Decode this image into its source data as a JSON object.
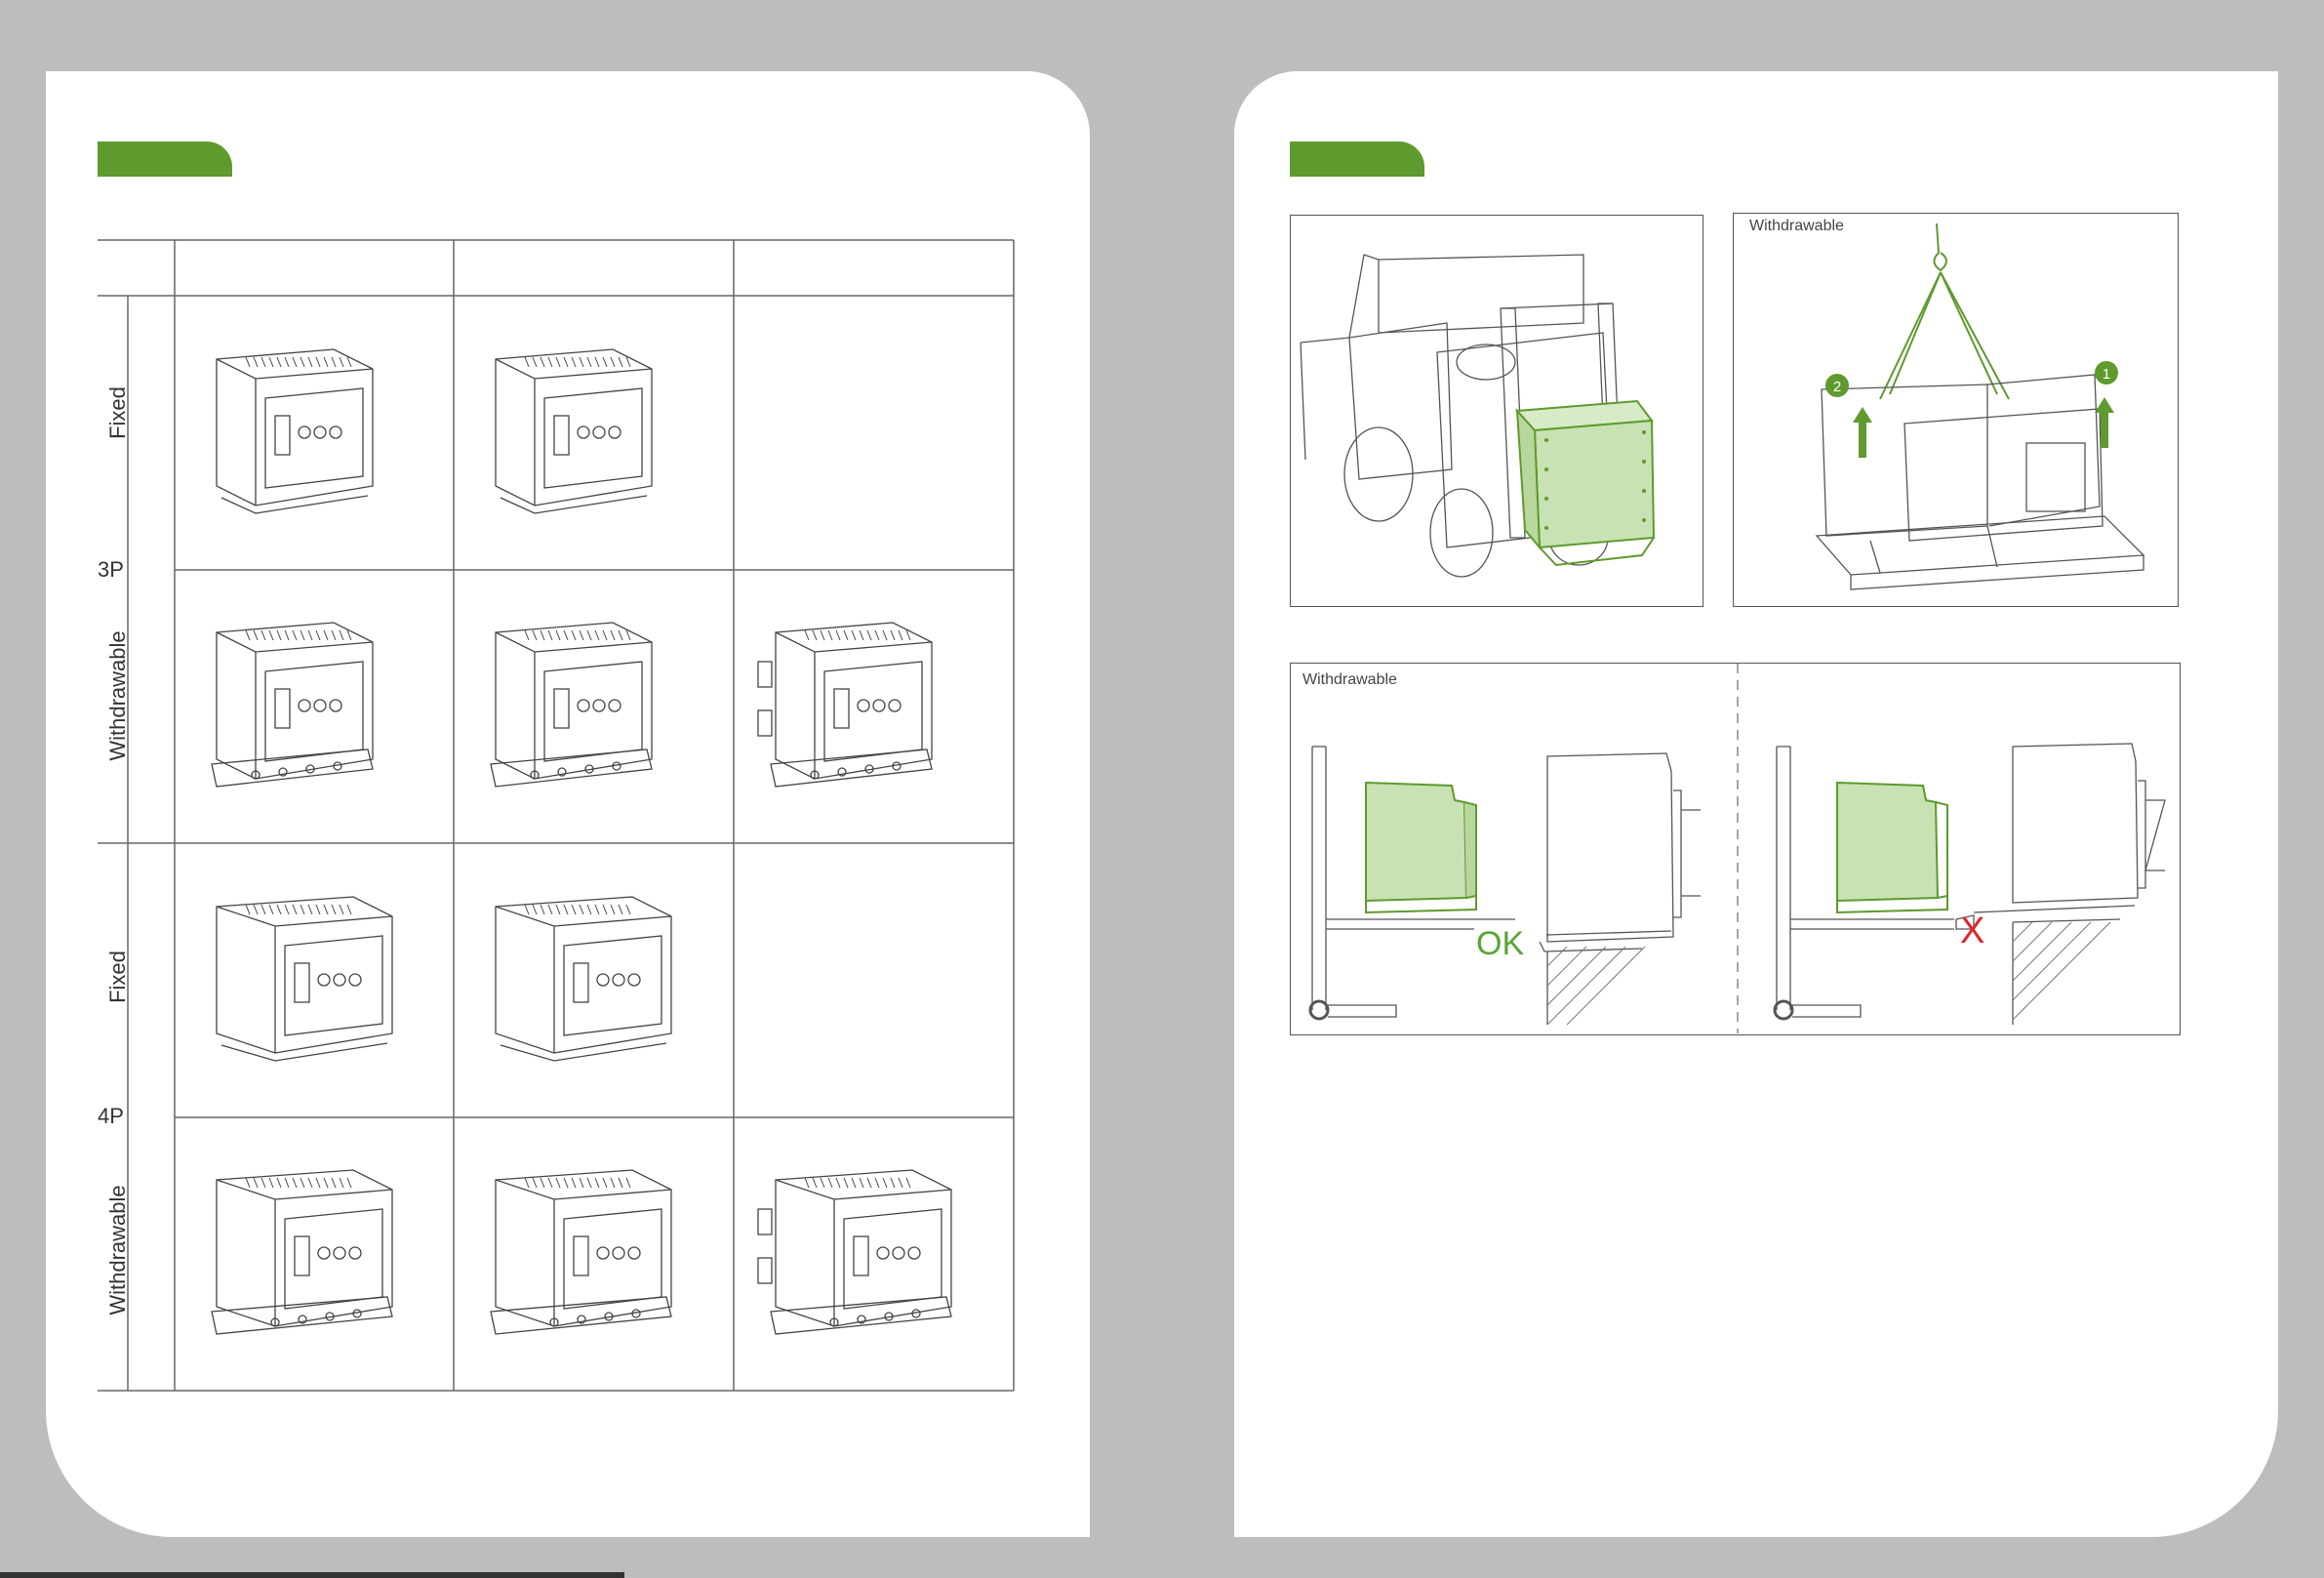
{
  "table": {
    "groups": [
      {
        "label": "3P",
        "rows": [
          {
            "label": "Fixed",
            "cells": [
              "fixed",
              "fixed",
              ""
            ]
          },
          {
            "label": "Withdrawable",
            "cells": [
              "withdrawable",
              "withdrawable",
              "withdrawable-rear"
            ]
          }
        ]
      },
      {
        "label": "4P",
        "rows": [
          {
            "label": "Fixed",
            "cells": [
              "fixed",
              "fixed",
              ""
            ]
          },
          {
            "label": "Withdrawable",
            "cells": [
              "withdrawable",
              "withdrawable",
              "withdrawable-rear"
            ]
          }
        ]
      }
    ]
  },
  "figures": {
    "forklift": {
      "label": ""
    },
    "lifting": {
      "label": "Withdrawable",
      "step_1": "1",
      "step_2": "2"
    },
    "insertion": {
      "label": "Withdrawable",
      "ok_text": "OK",
      "wrong_mark": "X"
    }
  },
  "colors": {
    "accent_green": "#5e9a2d",
    "light_green": "#c9e2b4",
    "error_red": "#e0252d",
    "page_bg": "#bdbdbd"
  }
}
